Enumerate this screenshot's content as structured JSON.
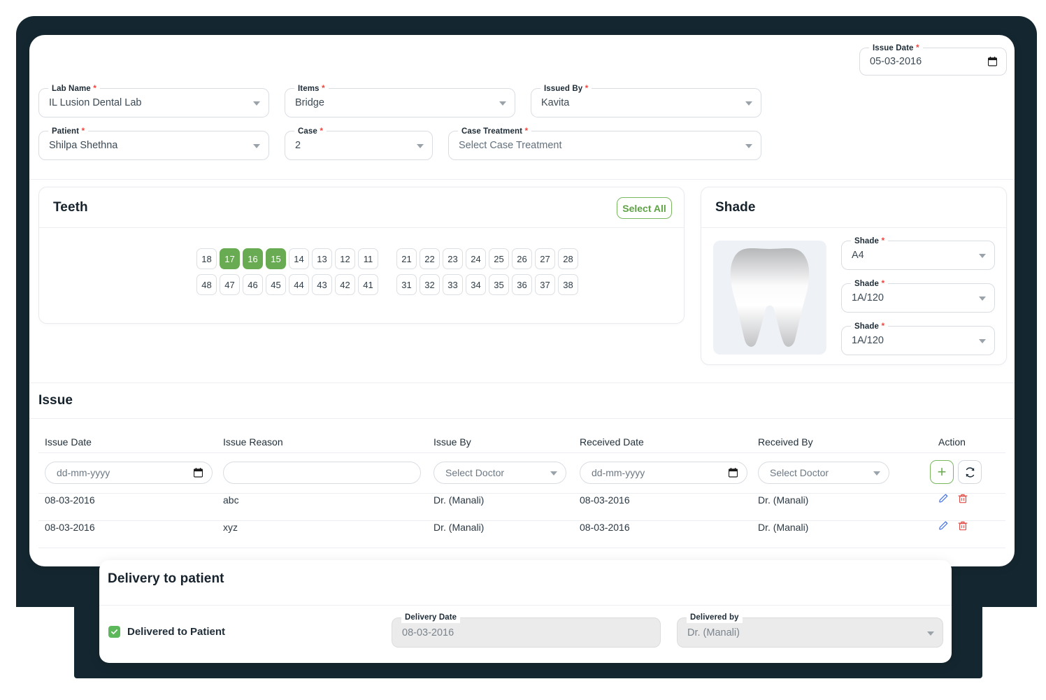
{
  "header": {
    "issue_date": {
      "label": "Issue Date",
      "required": true,
      "value": "05-03-2016",
      "icon": "calendar-icon"
    }
  },
  "form": {
    "lab_name": {
      "label": "Lab Name",
      "required": true,
      "value": "IL Lusion Dental Lab"
    },
    "items": {
      "label": "Items",
      "required": true,
      "value": "Bridge"
    },
    "issued_by": {
      "label": "Issued By",
      "required": true,
      "value": "Kavita"
    },
    "patient": {
      "label": "Patient",
      "required": true,
      "value": "Shilpa Shethna"
    },
    "case": {
      "label": "Case",
      "required": true,
      "value": "2"
    },
    "case_treatment": {
      "label": "Case Treatment",
      "required": true,
      "value": "Select Case Treatment",
      "is_placeholder": true
    }
  },
  "teeth": {
    "title": "Teeth",
    "select_all_label": "Select All",
    "selected": [
      "17",
      "16",
      "15"
    ],
    "rows": [
      {
        "left": [
          "18",
          "17",
          "16",
          "15",
          "14",
          "13",
          "12",
          "11"
        ],
        "right": [
          "21",
          "22",
          "23",
          "24",
          "25",
          "26",
          "27",
          "28"
        ]
      },
      {
        "left": [
          "48",
          "47",
          "46",
          "45",
          "44",
          "43",
          "42",
          "41"
        ],
        "right": [
          "31",
          "32",
          "33",
          "34",
          "35",
          "36",
          "37",
          "38"
        ]
      }
    ]
  },
  "shade": {
    "title": "Shade",
    "image_icon": "tooth-icon",
    "fields": [
      {
        "label": "Shade",
        "required": true,
        "value": "A4"
      },
      {
        "label": "Shade",
        "required": true,
        "value": "1A/120"
      },
      {
        "label": "Shade",
        "required": true,
        "value": "1A/120"
      }
    ]
  },
  "issue": {
    "title": "Issue",
    "columns": [
      "Issue Date",
      "Issue Reason",
      "Issue By",
      "Received Date",
      "Received By",
      "Action"
    ],
    "new_row": {
      "issue_date_placeholder": "dd-mm-yyyy",
      "issue_reason_placeholder": "",
      "issue_by_value": "Select Doctor",
      "received_date_placeholder": "dd-mm-yyyy",
      "received_by_value": "Select Doctor",
      "add_icon": "plus-icon",
      "refresh_icon": "refresh-icon"
    },
    "rows": [
      {
        "issue_date": "08-03-2016",
        "issue_reason": "abc",
        "issue_by": "Dr. (Manali)",
        "received_date": "08-03-2016",
        "received_by": "Dr. (Manali)",
        "edit_icon": "pencil-icon",
        "delete_icon": "trash-icon"
      },
      {
        "issue_date": "08-03-2016",
        "issue_reason": "xyz",
        "issue_by": "Dr. (Manali)",
        "received_date": "08-03-2016",
        "received_by": "Dr. (Manali)",
        "edit_icon": "pencil-icon",
        "delete_icon": "trash-icon"
      }
    ]
  },
  "delivery": {
    "title": "Delivery to patient",
    "checkbox_label": "Delivered to Patient",
    "checkbox_checked": true,
    "delivery_date": {
      "label": "Delivery Date",
      "value": "08-03-2016",
      "disabled": true
    },
    "delivered_by": {
      "label": "Delivered by",
      "value": "Dr. (Manali)",
      "disabled": true
    }
  },
  "colors": {
    "frame_navy": "#14262F",
    "accent_green": "#69AB52",
    "required_red": "#f2453d",
    "edit_blue": "#4a77e8",
    "delete_red": "#e0504a",
    "checkbox_green": "#5DB85C"
  }
}
